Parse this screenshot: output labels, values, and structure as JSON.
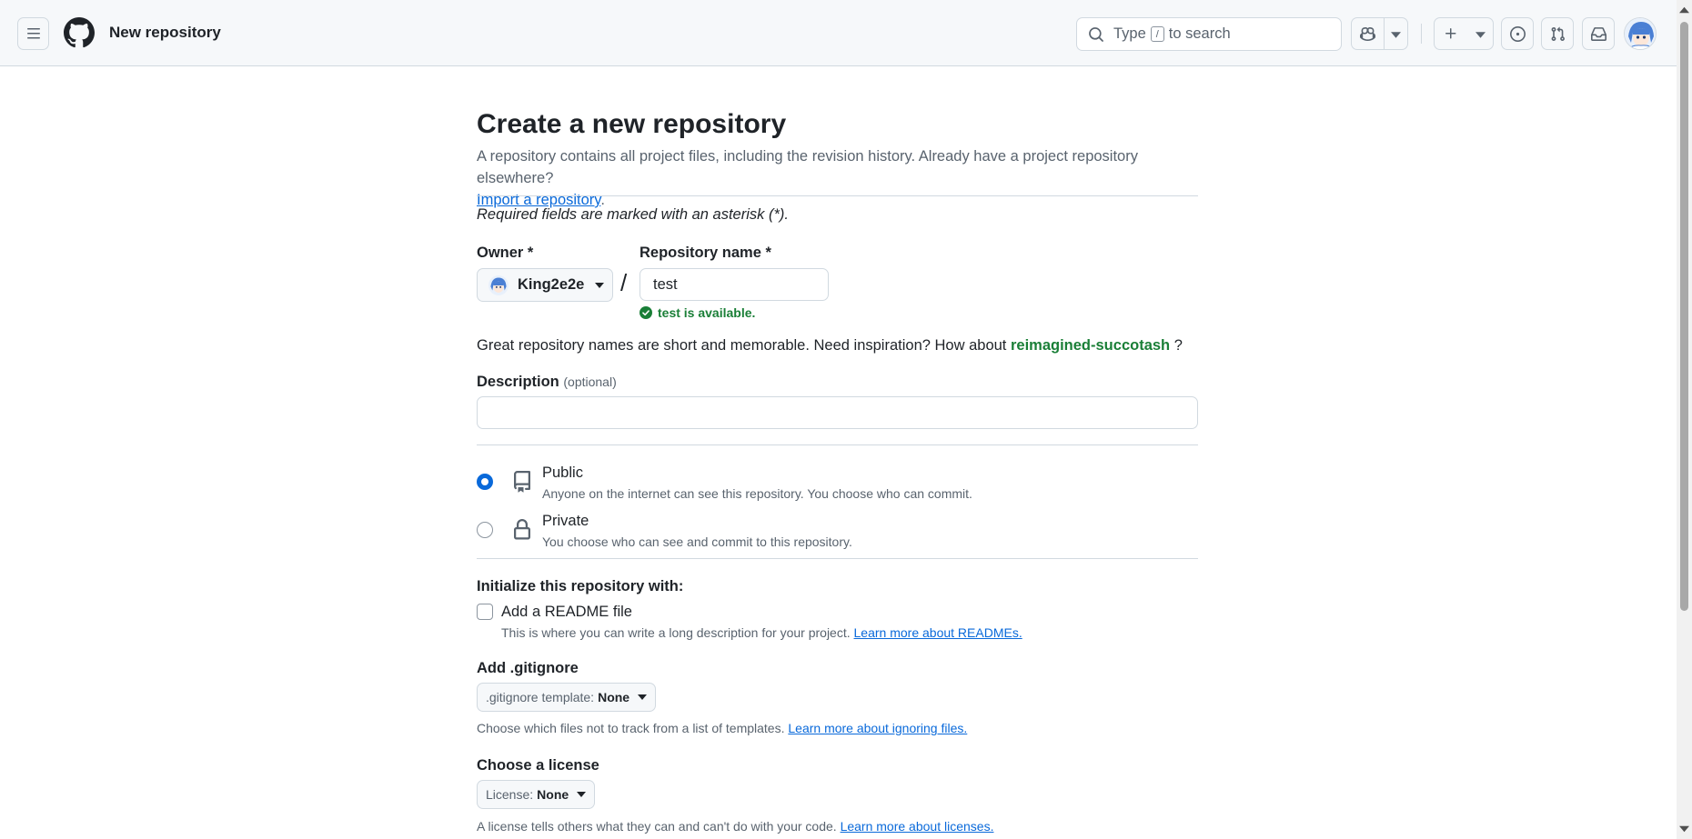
{
  "header": {
    "title": "New repository",
    "search_pre": "Type",
    "search_key": "/",
    "search_post": "to search"
  },
  "page": {
    "title": "Create a new repository",
    "intro": "A repository contains all project files, including the revision history. Already have a project repository elsewhere?",
    "import_link": "Import a repository",
    "import_suffix": ".",
    "required_note": "Required fields are marked with an asterisk (*)."
  },
  "form": {
    "owner_label": "Owner *",
    "owner_value": "King2e2e",
    "slash": "/",
    "repo_label": "Repository name *",
    "repo_value": "test",
    "availability": "test is available.",
    "inspiration_text": "Great repository names are short and memorable. Need inspiration? How about",
    "inspiration_suggestion": "reimagined-succotash",
    "inspiration_suffix": "?",
    "description_label": "Description",
    "description_optional": "(optional)",
    "description_value": ""
  },
  "visibility": {
    "selected": "Public",
    "options": [
      {
        "title": "Public",
        "desc": "Anyone on the internet can see this repository. You choose who can commit."
      },
      {
        "title": "Private",
        "desc": "You choose who can see and commit to this repository."
      }
    ]
  },
  "init": {
    "heading": "Initialize this repository with:",
    "readme_label": "Add a README file",
    "readme_checked": false,
    "readme_desc": "This is where you can write a long description for your project.",
    "readme_link": "Learn more about READMEs.",
    "gitignore_heading": "Add .gitignore",
    "gitignore_prefix": ".gitignore template:",
    "gitignore_value": "None",
    "gitignore_desc": "Choose which files not to track from a list of templates.",
    "gitignore_link": "Learn more about ignoring files.",
    "license_heading": "Choose a license",
    "license_prefix": "License:",
    "license_value": "None",
    "license_desc": "A license tells others what they can and can't do with your code.",
    "license_link": "Learn more about licenses."
  },
  "colors": {
    "accent": "#0969da",
    "success": "#1a7f37",
    "muted": "#59636e",
    "border": "#d1d9e0"
  },
  "icons": [
    "menu-icon",
    "github-logo-icon",
    "search-icon",
    "copilot-icon",
    "triangle-down-icon",
    "plus-icon",
    "issue-opened-icon",
    "git-pull-request-icon",
    "inbox-icon",
    "check-circle-icon",
    "repo-icon",
    "lock-icon"
  ]
}
